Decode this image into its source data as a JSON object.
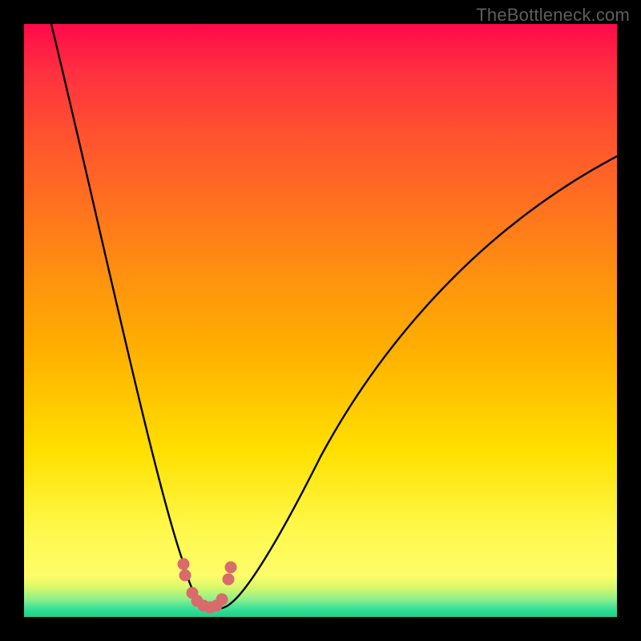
{
  "watermark": {
    "text": "TheBottleneck.com"
  },
  "chart_data": {
    "type": "line",
    "title": "",
    "xlabel": "",
    "ylabel": "",
    "xlim": [
      0,
      100
    ],
    "ylim": [
      0,
      100
    ],
    "series": [
      {
        "name": "bottleneck-curve",
        "x": [
          5,
          8,
          11,
          14,
          17,
          20,
          23,
          25,
          27,
          29,
          31,
          33,
          35,
          38,
          42,
          46,
          50,
          55,
          60,
          65,
          70,
          75,
          80,
          85,
          90,
          95,
          100
        ],
        "y": [
          100,
          90,
          80,
          70,
          60,
          50,
          40,
          32,
          24,
          17,
          10,
          5,
          2,
          2,
          5,
          12,
          20,
          30,
          40,
          48,
          55,
          61,
          66,
          70,
          73,
          76,
          78
        ]
      }
    ],
    "marker_points": {
      "name": "highlight-dots",
      "color": "#d96b6b",
      "x": [
        27.0,
        27.3,
        28.5,
        29.3,
        30.3,
        31.3,
        32.3,
        33.0,
        34.2,
        34.5
      ],
      "y": [
        8.0,
        6.0,
        3.2,
        2.3,
        1.8,
        1.8,
        2.3,
        3.2,
        6.0,
        8.0
      ]
    },
    "background": "rainbow-gradient-vertical"
  }
}
